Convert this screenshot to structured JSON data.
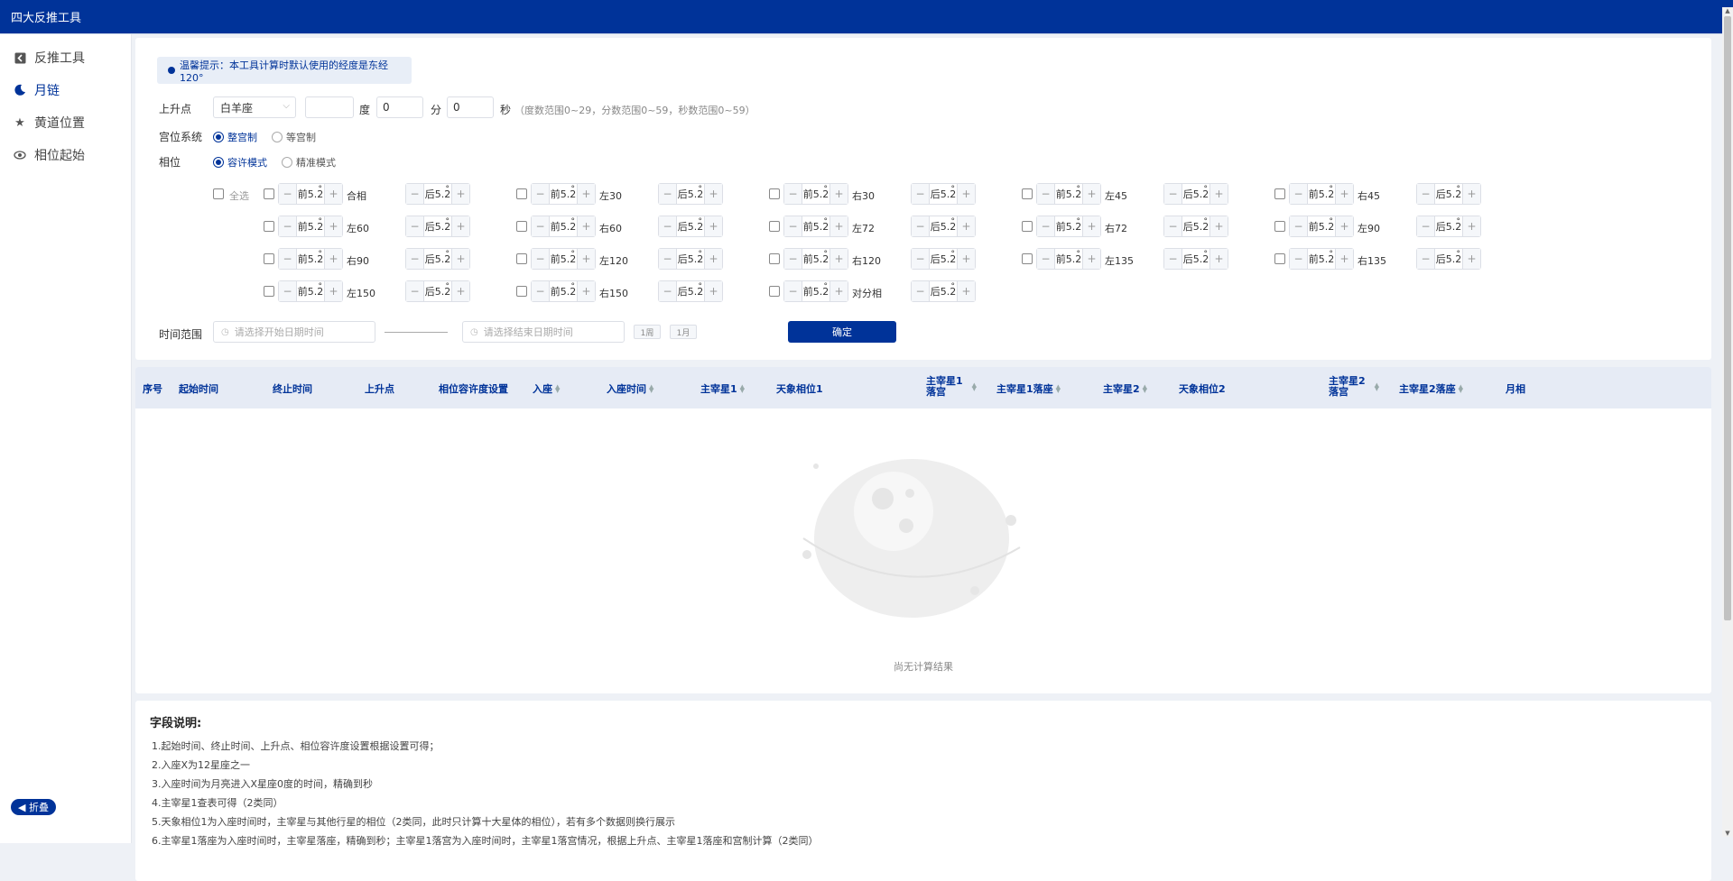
{
  "app": {
    "title": "四大反推工具"
  },
  "sidebar": {
    "items": [
      {
        "label": "反推工具",
        "icon": "back-square-icon"
      },
      {
        "label": "月链",
        "icon": "moon-icon",
        "active": true
      },
      {
        "label": "黄道位置",
        "icon": "star-icon"
      },
      {
        "label": "相位起始",
        "icon": "eye-icon"
      }
    ],
    "collapse_label": "◀ 折叠"
  },
  "form": {
    "tip": "温馨提示：本工具计算时默认使用的经度是东经120°",
    "ascendant_label": "上升点",
    "ascendant_sign": "白羊座",
    "degree_value": "",
    "degree_unit": "度",
    "minute_value": "0",
    "minute_unit": "分",
    "second_value": "0",
    "second_unit": "秒",
    "range_hint": "（度数范围0~29，分数范围0~59，秒数范围0~59）",
    "house_label": "宫位系统",
    "house_options": [
      "整宫制",
      "等宫制"
    ],
    "house_selected": "整宫制",
    "aspect_label": "相位",
    "aspect_options": [
      "容许模式",
      "精准模式"
    ],
    "aspect_selected": "容许模式",
    "select_all_label": "全选",
    "aspects": [
      {
        "name": "合相",
        "front": "前5.2",
        "back": "后5.2"
      },
      {
        "name": "左30",
        "front": "前5.2",
        "back": "后5.2"
      },
      {
        "name": "右30",
        "front": "前5.2",
        "back": "后5.2"
      },
      {
        "name": "左45",
        "front": "前5.2",
        "back": "后5.2"
      },
      {
        "name": "右45",
        "front": "前5.2",
        "back": "后5.2"
      },
      {
        "name": "左60",
        "front": "前5.2",
        "back": "后5.2"
      },
      {
        "name": "右60",
        "front": "前5.2",
        "back": "后5.2"
      },
      {
        "name": "左72",
        "front": "前5.2",
        "back": "后5.2"
      },
      {
        "name": "右72",
        "front": "前5.2",
        "back": "后5.2"
      },
      {
        "name": "左90",
        "front": "前5.2",
        "back": "后5.2"
      },
      {
        "name": "右90",
        "front": "前5.2",
        "back": "后5.2"
      },
      {
        "name": "左120",
        "front": "前5.2",
        "back": "后5.2"
      },
      {
        "name": "右120",
        "front": "前5.2",
        "back": "后5.2"
      },
      {
        "name": "左135",
        "front": "前5.2",
        "back": "后5.2"
      },
      {
        "name": "右135",
        "front": "前5.2",
        "back": "后5.2"
      },
      {
        "name": "左150",
        "front": "前5.2",
        "back": "后5.2"
      },
      {
        "name": "右150",
        "front": "前5.2",
        "back": "后5.2"
      },
      {
        "name": "对分相",
        "front": "前5.2",
        "back": "后5.2"
      }
    ],
    "time_range_label": "时间范围",
    "start_placeholder": "请选择开始日期时间",
    "end_placeholder": "请选择结束日期时间",
    "quick_week": "1周",
    "quick_month": "1月",
    "confirm_label": "确定"
  },
  "table": {
    "columns": [
      "序号",
      "起始时间",
      "终止时间",
      "上升点",
      "相位容许度设置",
      "入座",
      "入座时间",
      "主宰星1",
      "天象相位1",
      "主宰星1落宫",
      "主宰星1落座",
      "主宰星2",
      "天象相位2",
      "主宰星2落宫",
      "主宰星2落座",
      "月相"
    ],
    "empty_text": "尚无计算结果"
  },
  "notes": {
    "title": "字段说明:",
    "lines": [
      "1.起始时间、终止时间、上升点、相位容许度设置根据设置可得；",
      "2.入座X为12星座之一",
      "3.入座时间为月亮进入X星座0度的时间，精确到秒",
      "4.主宰星1查表可得（2类同）",
      "5.天象相位1为入座时间时，主宰星与其他行星的相位（2类同，此时只计算十大星体的相位），若有多个数据则换行展示",
      "6.主宰星1落座为入座时间时，主宰星落座，精确到秒；主宰星1落宫为入座时间时，主宰星1落宫情况，根据上升点、主宰星1落座和宫制计算（2类同）"
    ]
  }
}
